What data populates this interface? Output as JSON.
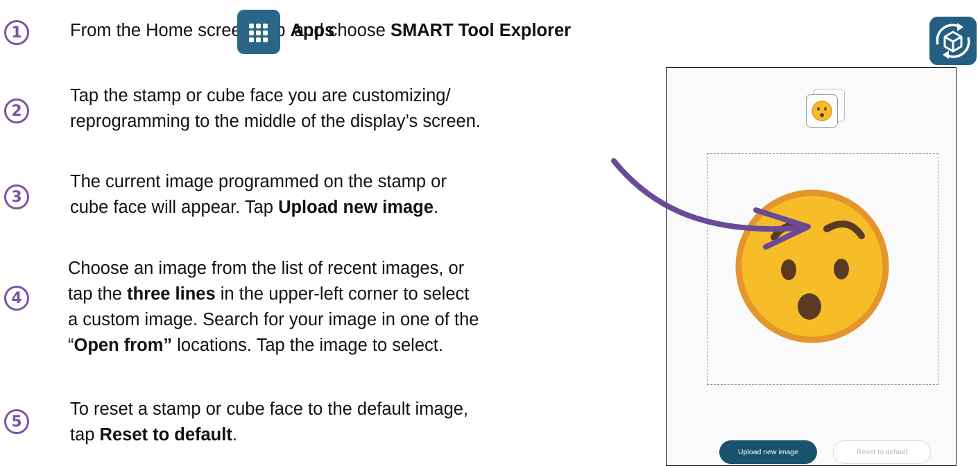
{
  "steps": [
    {
      "number": "1",
      "text_before": "From the Home screen, tap ",
      "bold1": "Apps",
      "text_middle": " and choose ",
      "bold2": "SMART Tool Explorer"
    },
    {
      "number": "2",
      "line1": "Tap the stamp or cube face you are customizing/",
      "line2": "reprogramming to the middle of the display’s screen."
    },
    {
      "number": "3",
      "line1": "The current image programmed on the stamp or",
      "line2_before": "cube face will appear. Tap ",
      "line2_bold": "Upload new image",
      "line2_after": "."
    },
    {
      "number": "4",
      "line1": "Choose an image from the list of recent images, or",
      "line2_before": "tap the ",
      "line2_bold": "three lines",
      "line2_after": " in the upper-left corner to select",
      "line3": "a custom image. Search for your image in one of the",
      "line4_before": "“",
      "line4_bold": "Open from”",
      "line4_after": " locations. Tap the image to select."
    },
    {
      "number": "5",
      "line1": "To reset a stamp or cube face to the default image,",
      "line2_before": "tap ",
      "line2_bold": "Reset to default",
      "line2_after": "."
    }
  ],
  "icons": {
    "apps": "apps-grid-icon",
    "smart_tool_explorer": "smart-tool-explorer-cube-icon",
    "arrow": "curved-arrow",
    "emoji": "surprised-face-emoji"
  },
  "screen": {
    "upload_button": "Upload new image",
    "reset_button": "Reset to default"
  },
  "colors": {
    "step_number": "#7b52a6",
    "arrow": "#6a4a96",
    "upload_button": "#17536f",
    "app_icon": "#2b6688",
    "emoji_face": "#f7bd28",
    "emoji_ring": "#e4952b",
    "emoji_features": "#5a3a22"
  }
}
